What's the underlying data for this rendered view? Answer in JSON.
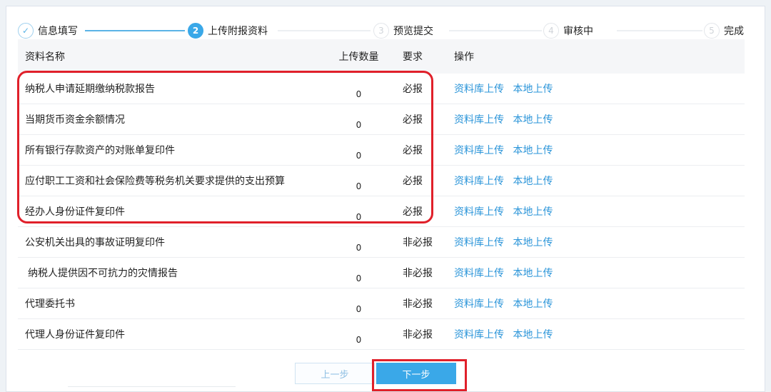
{
  "steps": [
    {
      "index": "✓",
      "label": "信息填写",
      "state": "done"
    },
    {
      "index": "2",
      "label": "上传附报资料",
      "state": "active"
    },
    {
      "index": "3",
      "label": "预览提交",
      "state": "pending"
    },
    {
      "index": "4",
      "label": "审核中",
      "state": "pending"
    },
    {
      "index": "5",
      "label": "完成",
      "state": "pending"
    }
  ],
  "table": {
    "headers": {
      "name": "资料名称",
      "count": "上传数量",
      "requirement": "要求",
      "operation": "操作"
    },
    "rows": [
      {
        "name": "纳税人申请延期缴纳税款报告",
        "count": "0",
        "requirement": "必报",
        "op1": "资料库上传",
        "op2": "本地上传"
      },
      {
        "name": "当期货币资金余额情况",
        "count": "0",
        "requirement": "必报",
        "op1": "资料库上传",
        "op2": "本地上传"
      },
      {
        "name": "所有银行存款资产的对账单复印件",
        "count": "0",
        "requirement": "必报",
        "op1": "资料库上传",
        "op2": "本地上传"
      },
      {
        "name": "应付职工工资和社会保险费等税务机关要求提供的支出预算",
        "count": "0",
        "requirement": "必报",
        "op1": "资料库上传",
        "op2": "本地上传"
      },
      {
        "name": "经办人身份证件复印件",
        "count": "0",
        "requirement": "必报",
        "op1": "资料库上传",
        "op2": "本地上传"
      },
      {
        "name": "公安机关出具的事故证明复印件",
        "count": "0",
        "requirement": "非必报",
        "op1": "资料库上传",
        "op2": "本地上传"
      },
      {
        "name": "纳税人提供因不可抗力的灾情报告",
        "count": "0",
        "requirement": "非必报",
        "op1": "资料库上传",
        "op2": "本地上传"
      },
      {
        "name": "代理委托书",
        "count": "0",
        "requirement": "非必报",
        "op1": "资料库上传",
        "op2": "本地上传"
      },
      {
        "name": "代理人身份证件复印件",
        "count": "0",
        "requirement": "非必报",
        "op1": "资料库上传",
        "op2": "本地上传"
      }
    ]
  },
  "buttons": {
    "prev": "上一步",
    "next": "下一步"
  },
  "colors": {
    "accent": "#3aa8e8",
    "link": "#2b95d9",
    "highlight": "#e0202a"
  }
}
